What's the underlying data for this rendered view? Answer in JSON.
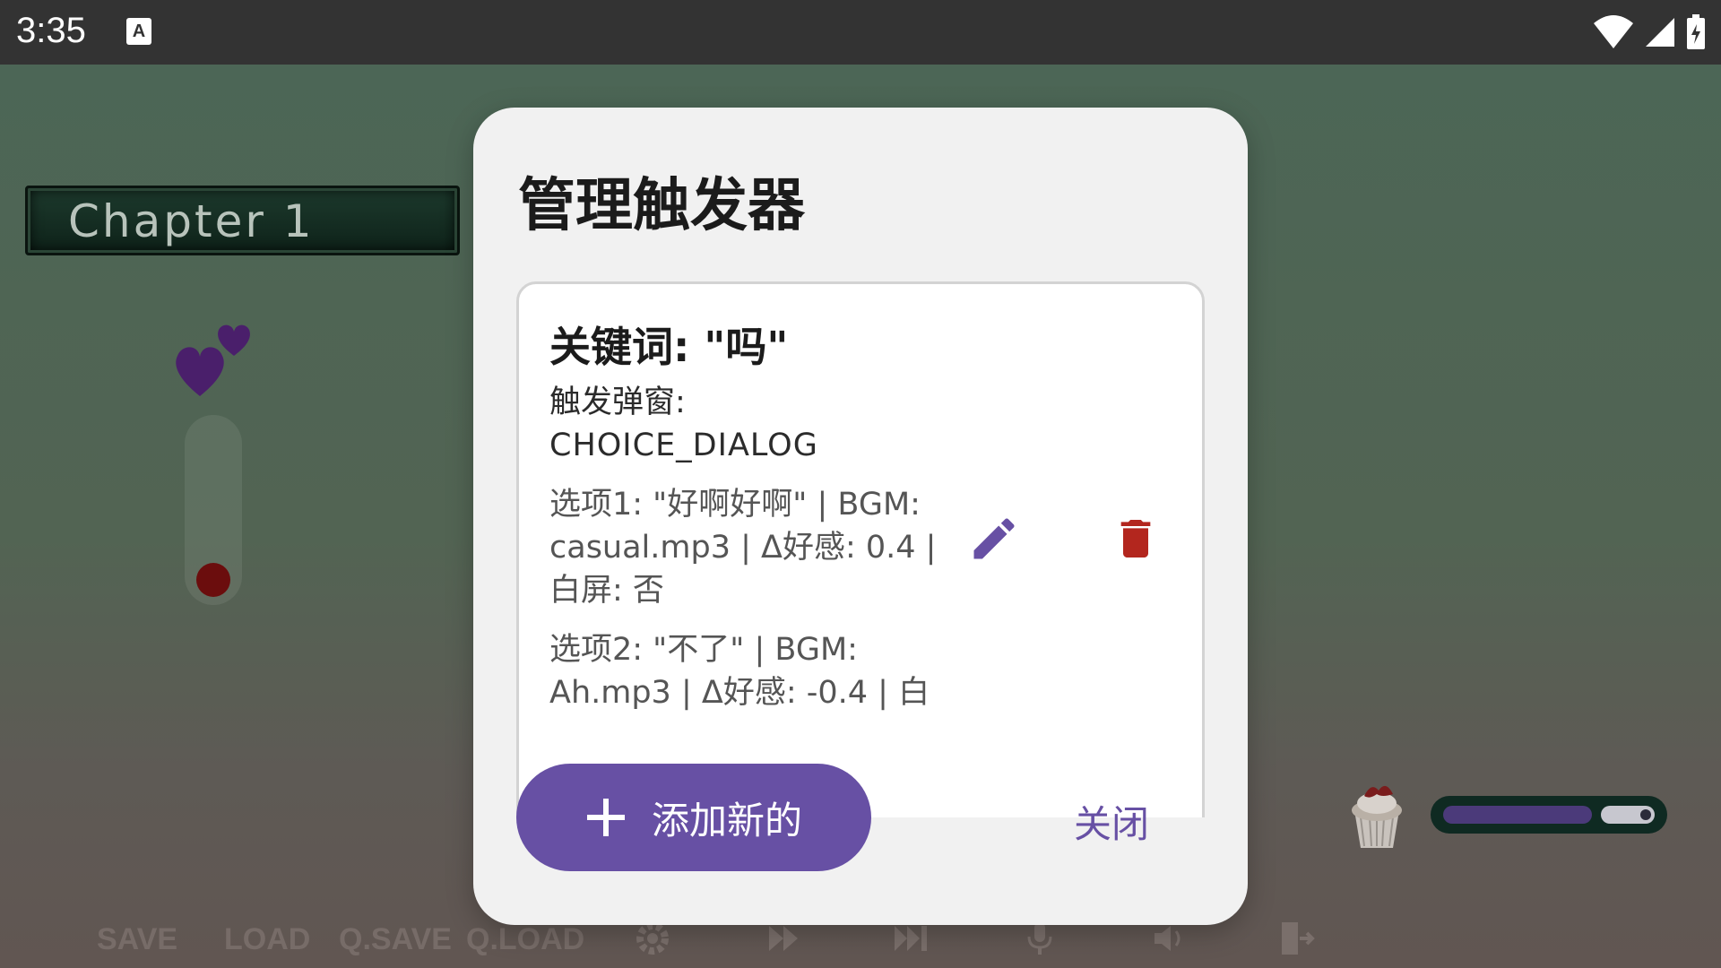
{
  "status_bar": {
    "time": "3:35",
    "notification_icon": "a-icon",
    "icons": [
      "wifi-icon",
      "cellular-signal-icon",
      "battery-charging-icon"
    ]
  },
  "game": {
    "chapter_title": "Chapter 1",
    "affection_level": 0.0,
    "progress_fraction": 0.65,
    "bottom_menu": {
      "save": "SAVE",
      "load": "LOAD",
      "qsave": "Q.SAVE",
      "qload": "Q.LOAD",
      "icons": [
        "settings-icon",
        "fast-forward-icon",
        "skip-icon",
        "microphone-icon",
        "volume-icon",
        "exit-icon"
      ]
    }
  },
  "dialog": {
    "title": "管理触发器",
    "triggers": [
      {
        "keyword": "关键词: \"吗\"",
        "popup_label": "触发弹窗:",
        "popup_value": "CHOICE_DIALOG",
        "option1": "选项1: \"好啊好啊\" | BGM: casual.mp3 | Δ好感: 0.4 | 白屏: 否",
        "option2": "选项2: \"不了\" | BGM: Ah.mp3 | Δ好感: -0.4 | 白"
      }
    ],
    "add_button_label": "添加新的",
    "close_button_label": "关闭"
  },
  "colors": {
    "accent": "#6750a4",
    "delete": "#b3261e",
    "status_bar": "#333333"
  }
}
